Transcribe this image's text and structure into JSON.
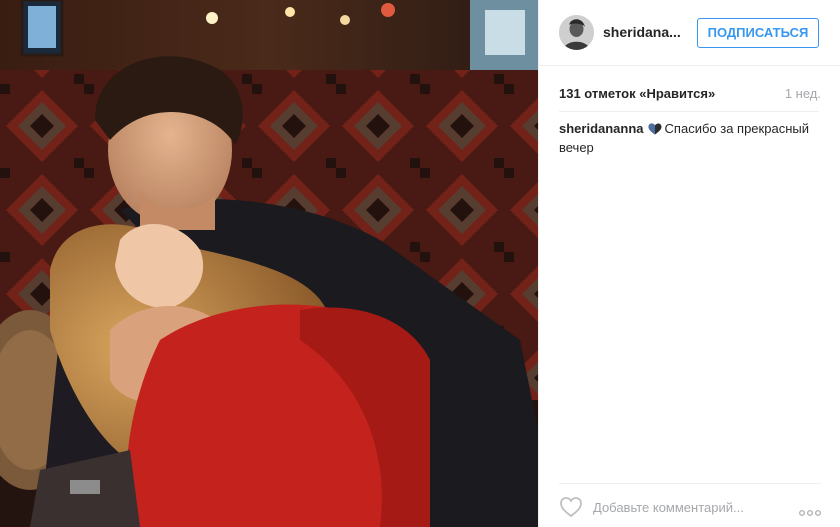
{
  "post": {
    "photo_alt": "",
    "header": {
      "username": "sheridana...",
      "follow_label": "ПОДПИСАТЬСЯ"
    },
    "meta": {
      "likes_text": "131 отметок «Нравится»",
      "time_text": "1 нед."
    },
    "caption": {
      "author": "sheridananna",
      "text": "Спасибо за прекрасный вечер"
    },
    "footer": {
      "comment_placeholder": "Добавьте комментарий..."
    }
  },
  "colors": {
    "accent": "#3897f0",
    "text": "#262626",
    "muted": "#a5a7aa",
    "divider": "#efefef"
  },
  "icons": {
    "avatar": "user-avatar",
    "like": "heart-outline-icon",
    "more": "more-options-icon",
    "caption_emoji": "heart-emoji-icon"
  }
}
